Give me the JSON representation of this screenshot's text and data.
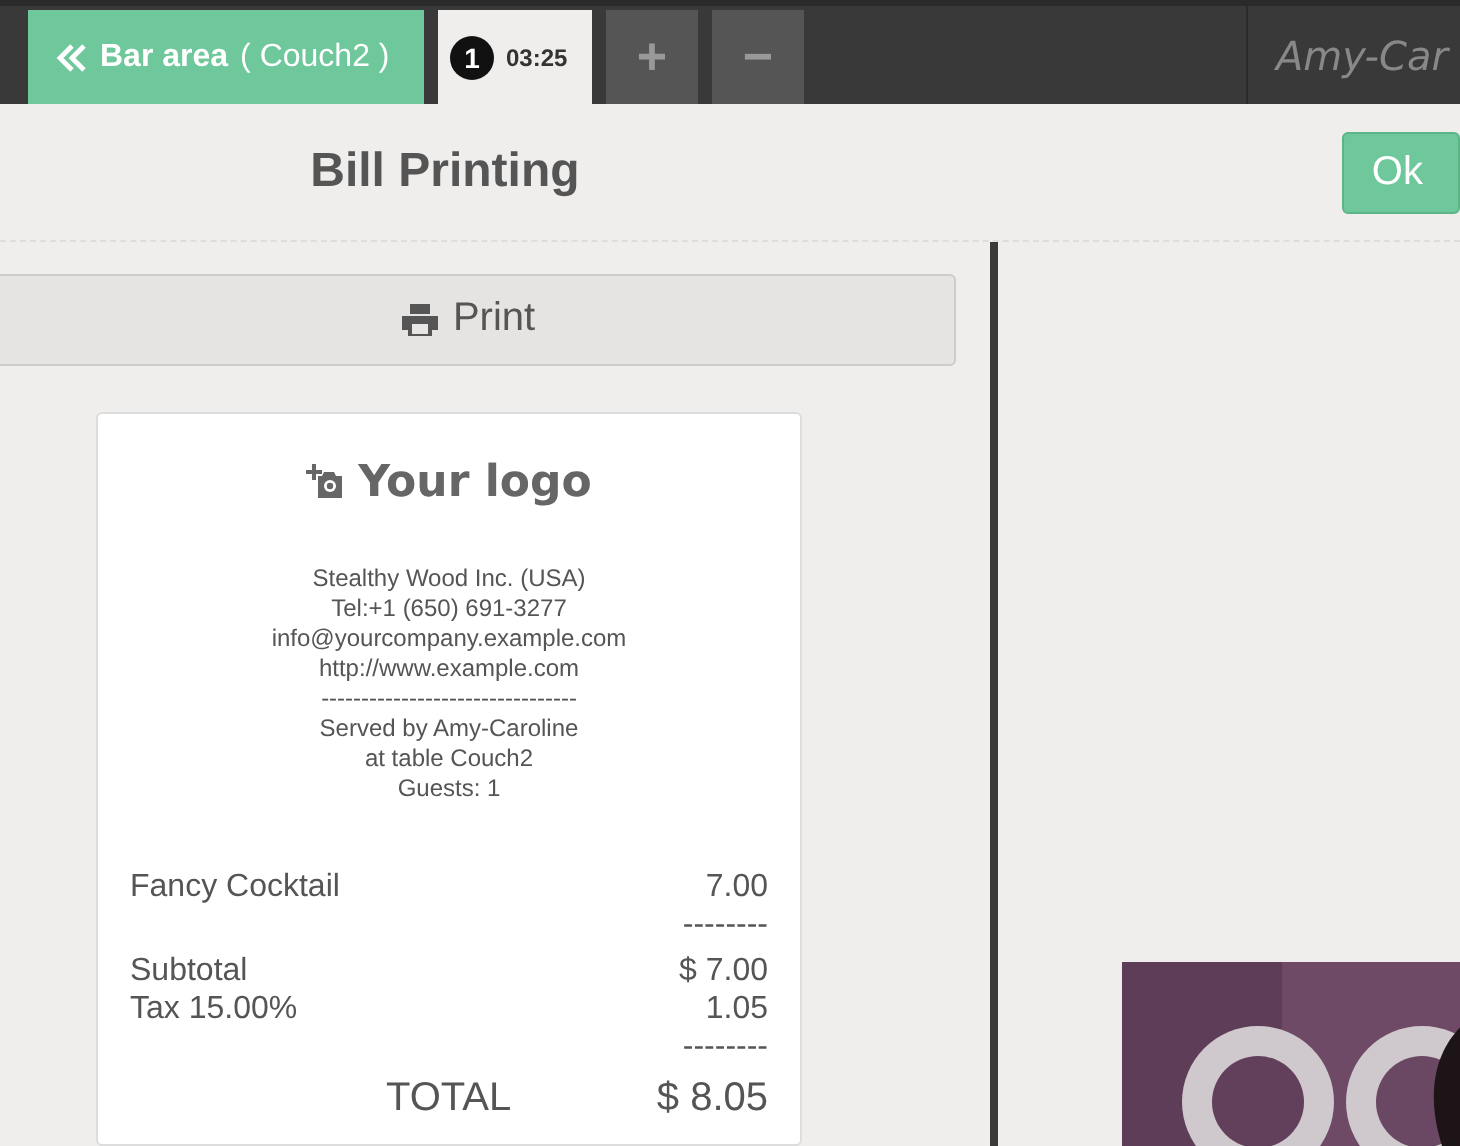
{
  "top_bar": {
    "back_button": {
      "label": "Bar area",
      "detail": "( Couch2 )"
    },
    "orders": [
      {
        "number": "1",
        "time": "03:25",
        "selected": true
      }
    ],
    "add_button": "+",
    "remove_button": "−",
    "user": "Amy-Car"
  },
  "screen": {
    "title": "Bill Printing",
    "ok_button": "Ok",
    "print_button": "Print"
  },
  "receipt": {
    "logo": "Your logo",
    "header_lines": [
      "Stealthy Wood Inc. (USA)",
      "Tel:+1 (650) 691-3277",
      "info@yourcompany.example.com",
      "http://www.example.com",
      "--------------------------------",
      "Served by Amy-Caroline",
      "at table Couch2",
      "Guests: 1"
    ],
    "lines": [
      {
        "kind": "item",
        "label": "Fancy Cocktail",
        "amount": "7.00"
      },
      {
        "kind": "rule",
        "amount": "--------"
      },
      {
        "kind": "item",
        "label": "Subtotal",
        "amount": "$ 7.00"
      },
      {
        "kind": "item",
        "label": "Tax 15.00%",
        "amount": "1.05"
      },
      {
        "kind": "rule",
        "amount": "--------"
      },
      {
        "kind": "total",
        "label": "TOTAL",
        "amount": "$ 8.05"
      }
    ]
  }
}
